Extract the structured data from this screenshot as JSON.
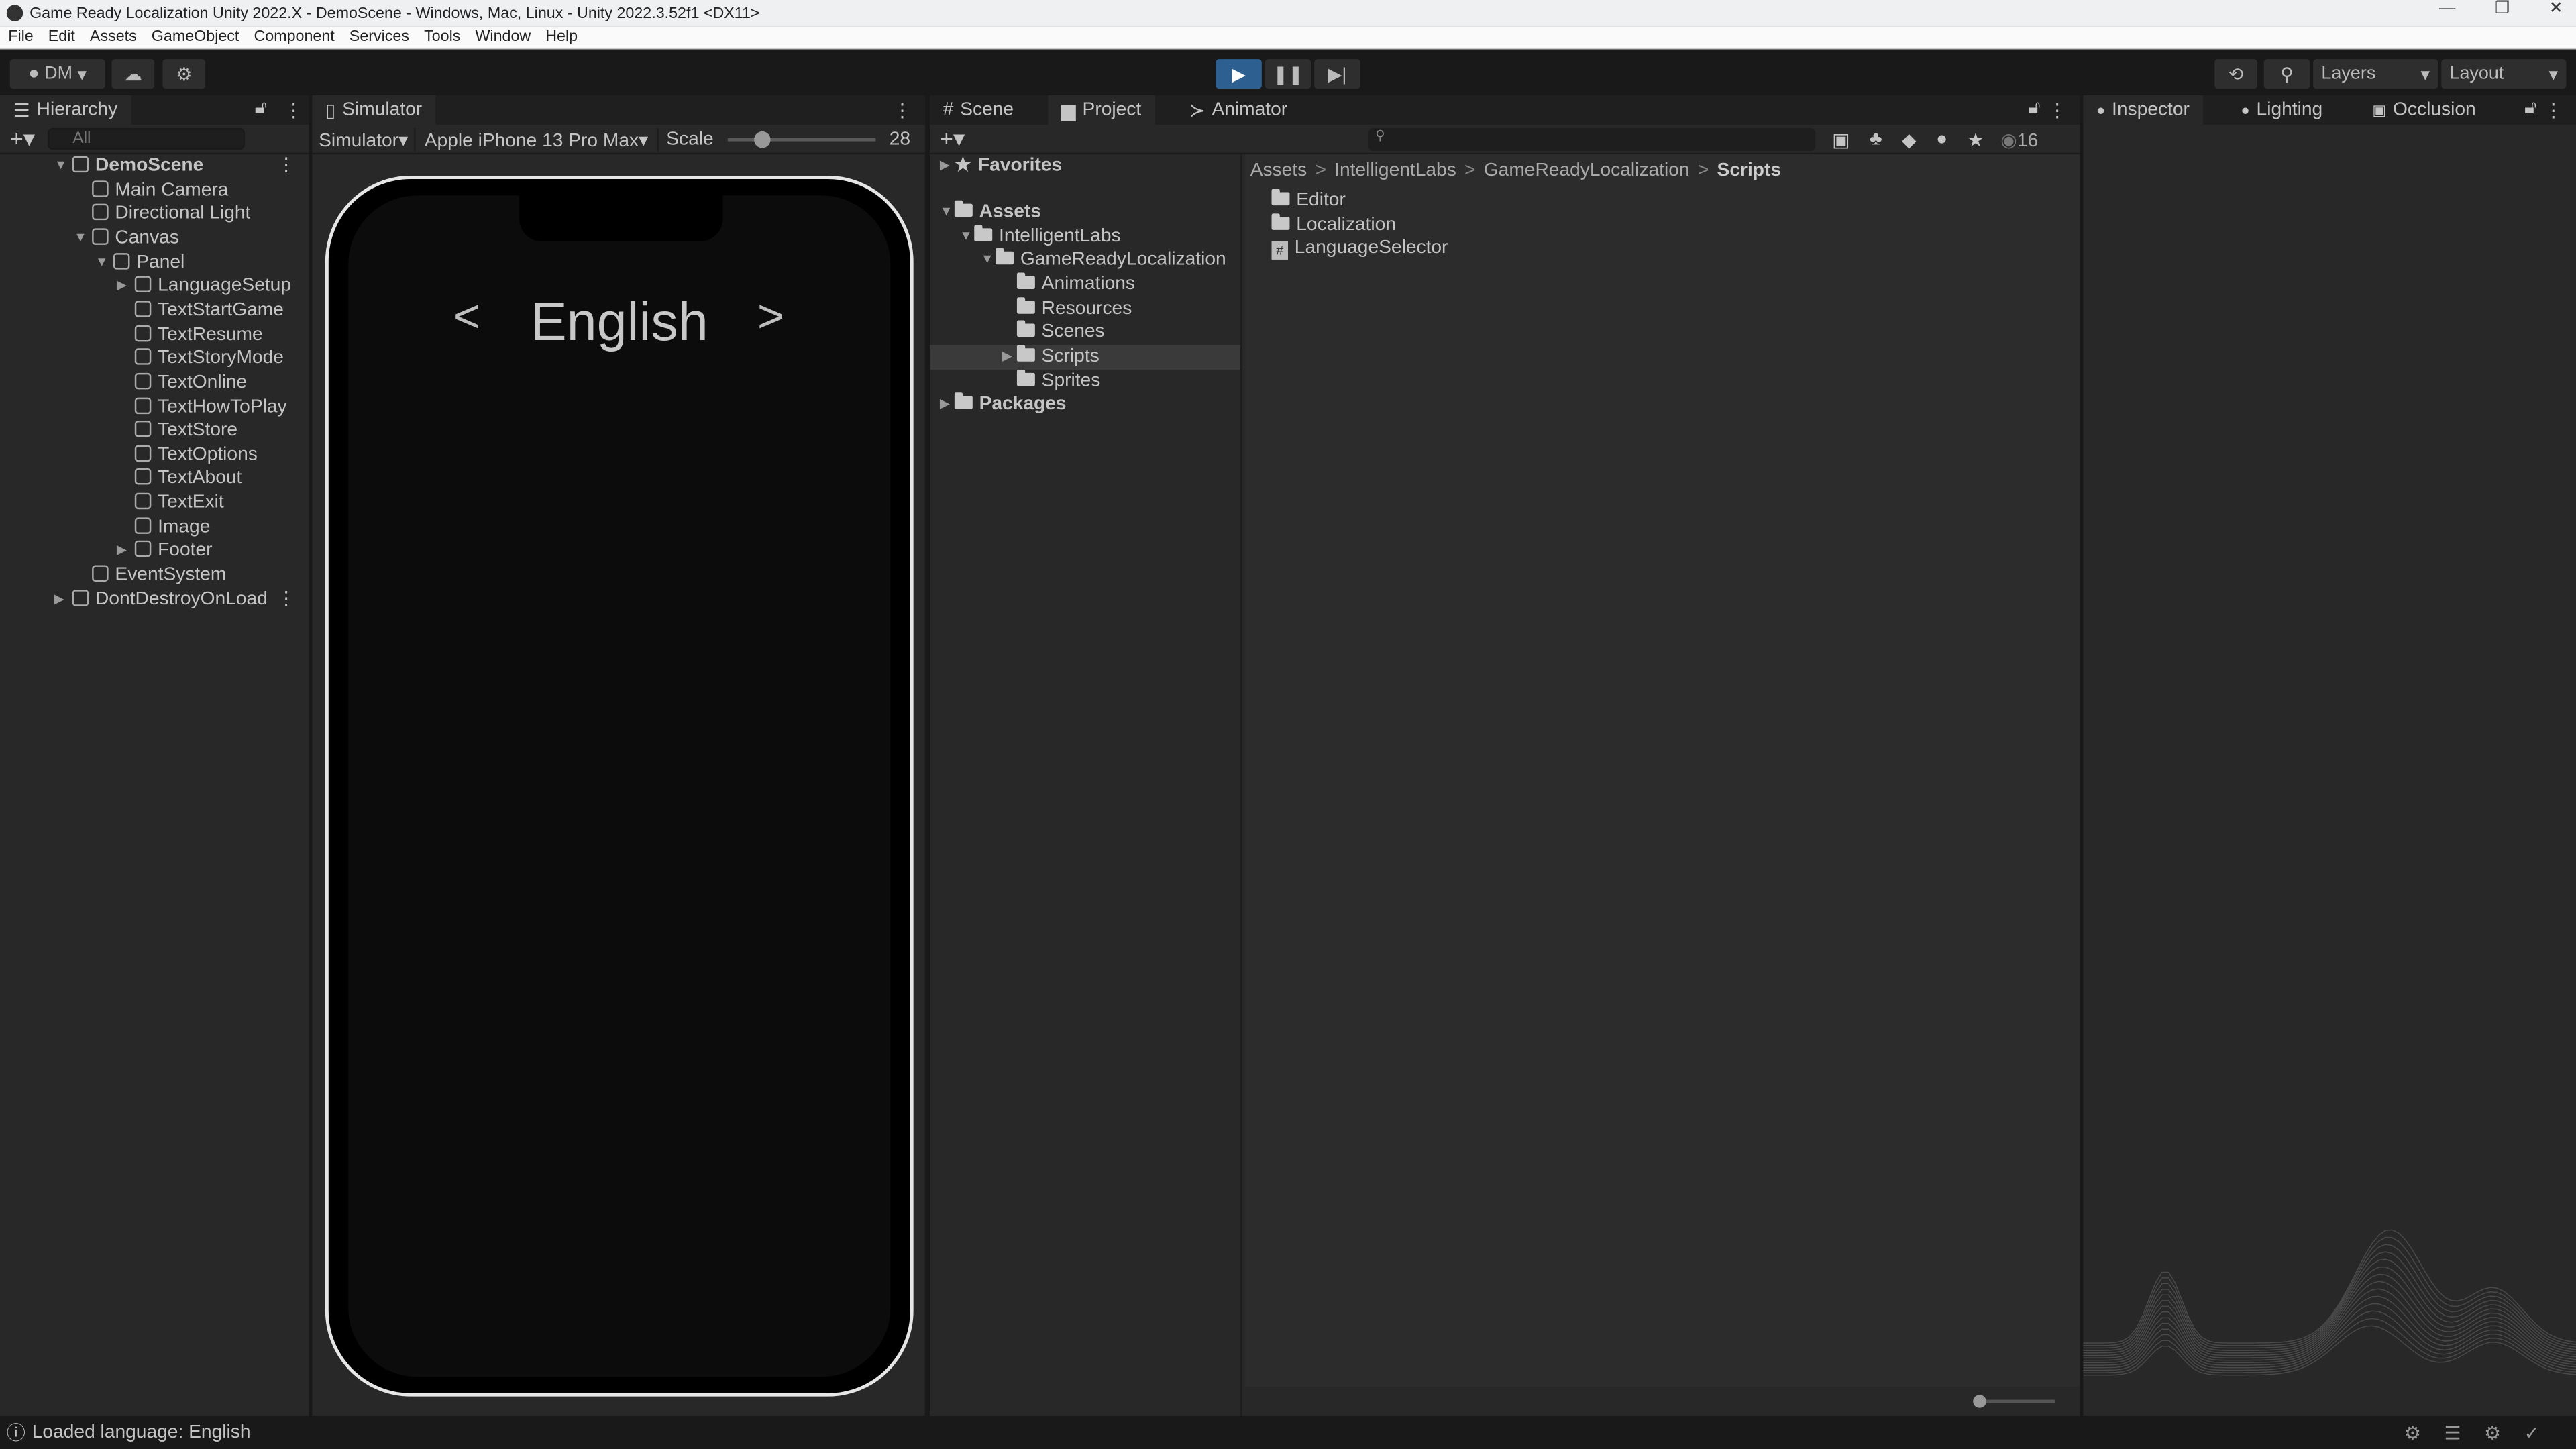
{
  "window": {
    "title": "Game Ready Localization Unity 2022.X - DemoScene - Windows, Mac, Linux - Unity 2022.3.52f1 <DX11>"
  },
  "menu": [
    "File",
    "Edit",
    "Assets",
    "GameObject",
    "Component",
    "Services",
    "Tools",
    "Window",
    "Help"
  ],
  "toolbar": {
    "account": "DM",
    "layers": "Layers",
    "layout": "Layout",
    "accent": "#2d5f91"
  },
  "hierarchy": {
    "tab": "Hierarchy",
    "search_placeholder": "All",
    "items": [
      {
        "label": "DemoScene",
        "level": 0,
        "bold": true,
        "arrow": "down"
      },
      {
        "label": "Main Camera",
        "level": 1
      },
      {
        "label": "Directional Light",
        "level": 1
      },
      {
        "label": "Canvas",
        "level": 1,
        "arrow": "down"
      },
      {
        "label": "Panel",
        "level": 2,
        "arrow": "down"
      },
      {
        "label": "LanguageSetup",
        "level": 3,
        "arrow": "right"
      },
      {
        "label": "TextStartGame",
        "level": 3
      },
      {
        "label": "TextResume",
        "level": 3
      },
      {
        "label": "TextStoryMode",
        "level": 3
      },
      {
        "label": "TextOnline",
        "level": 3
      },
      {
        "label": "TextHowToPlay",
        "level": 3
      },
      {
        "label": "TextStore",
        "level": 3
      },
      {
        "label": "TextOptions",
        "level": 3
      },
      {
        "label": "TextAbout",
        "level": 3
      },
      {
        "label": "TextExit",
        "level": 3
      },
      {
        "label": "Image",
        "level": 3
      },
      {
        "label": "Footer",
        "level": 3,
        "arrow": "right"
      },
      {
        "label": "EventSystem",
        "level": 1
      },
      {
        "label": "DontDestroyOnLoad",
        "level": 0,
        "arrow": "right"
      }
    ]
  },
  "simulator": {
    "tab": "Simulator",
    "mode": "Simulator",
    "device": "Apple iPhone 13 Pro Max",
    "scale_label": "Scale",
    "scale_value": "28",
    "scale_fraction": 0.2,
    "language": "English"
  },
  "project": {
    "tabs": [
      "Scene",
      "Project",
      "Animator"
    ],
    "count": "16",
    "tree": [
      {
        "label": "Favorites",
        "level": 0,
        "bold": true,
        "icon": "star"
      },
      {
        "label": "Assets",
        "level": 0,
        "bold": true,
        "icon": "folder-open",
        "gap": true
      },
      {
        "label": "IntelligentLabs",
        "level": 1,
        "icon": "folder-open"
      },
      {
        "label": "GameReadyLocalization",
        "level": 2,
        "icon": "folder-open"
      },
      {
        "label": "Animations",
        "level": 3,
        "icon": "folder"
      },
      {
        "label": "Resources",
        "level": 3,
        "icon": "folder"
      },
      {
        "label": "Scenes",
        "level": 3,
        "icon": "folder"
      },
      {
        "label": "Scripts",
        "level": 3,
        "icon": "folder",
        "selected": true
      },
      {
        "label": "Sprites",
        "level": 3,
        "icon": "folder"
      },
      {
        "label": "Packages",
        "level": 0,
        "bold": true,
        "icon": "folder"
      }
    ],
    "breadcrumb": [
      "Assets",
      "IntelligentLabs",
      "GameReadyLocalization",
      "Scripts"
    ],
    "files": [
      {
        "label": "Editor",
        "icon": "folder"
      },
      {
        "label": "Localization",
        "icon": "folder"
      },
      {
        "label": "LanguageSelector",
        "icon": "script"
      }
    ]
  },
  "inspector": {
    "tabs": [
      "Inspector",
      "Lighting",
      "Occlusion"
    ]
  },
  "status": {
    "message": "Loaded language: English"
  }
}
